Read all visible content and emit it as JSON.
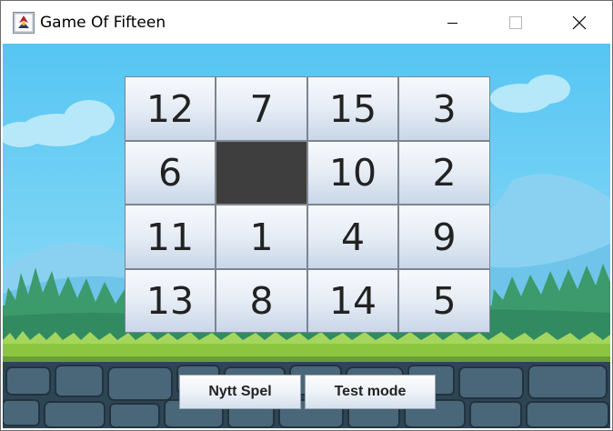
{
  "window": {
    "title": "Game Of Fifteen"
  },
  "board": {
    "rows": [
      [
        "12",
        "7",
        "15",
        "3"
      ],
      [
        "6",
        "",
        "10",
        "2"
      ],
      [
        "11",
        "1",
        "4",
        "9"
      ],
      [
        "13",
        "8",
        "14",
        "5"
      ]
    ]
  },
  "controls": {
    "new_game_label": "Nytt Spel",
    "test_mode_label": "Test mode"
  },
  "colors": {
    "sky": "#5fc8f2",
    "grass": "#3d9a6b",
    "stone": "#3f5b6e",
    "empty_tile": "#3e3e3e"
  }
}
